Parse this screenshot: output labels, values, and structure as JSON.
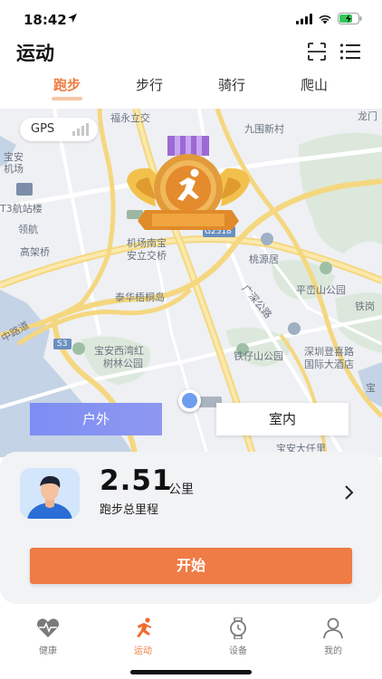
{
  "status_bar": {
    "time": "18:42"
  },
  "header": {
    "title": "运动",
    "icons": [
      "scan-icon",
      "menu-icon"
    ]
  },
  "tabs": [
    {
      "label": "跑步",
      "active": true
    },
    {
      "label": "步行",
      "active": false
    },
    {
      "label": "骑行",
      "active": false
    },
    {
      "label": "爬山",
      "active": false
    }
  ],
  "map": {
    "gps_label": "GPS",
    "labels": {
      "fuyongli": "福永立交",
      "jiuwei": "九围新村",
      "longhua": "龙门",
      "baoan_airport": "宝安",
      "jichang": "机场",
      "t3": "T3航站楼",
      "jichangnanbao": "机场南宝",
      "anlijiaoqiao": "安立交桥",
      "g2518": "G2518",
      "taoyuanju": "桃源居",
      "pingluanshan": "平峦山公园",
      "taihua": "泰华梧桐岛",
      "tiegang": "铁岗",
      "guangshen": "广深公路",
      "s3": "S3",
      "baoanxiwan": "宝安西湾红",
      "shulin": "树林公园",
      "tieziyshan": "铁仔山公园",
      "shenzhendengxi": "深圳登喜路",
      "guojidajiudian": "国际大酒店",
      "zhongjiedao": "中路道",
      "lingfeng": "领航",
      "gaojia": "高架桥",
      "baoandaqian": "宝安大仟里",
      "baolabel": "宝"
    },
    "mode_outdoor": "户外",
    "mode_indoor": "室内"
  },
  "summary": {
    "distance_value": "2.51",
    "distance_unit": "公里",
    "distance_label": "跑步总里程",
    "start_label": "开始"
  },
  "bottom_nav": [
    {
      "label": "健康",
      "icon": "heart-pulse-icon",
      "active": false
    },
    {
      "label": "运动",
      "icon": "runner-icon",
      "active": true
    },
    {
      "label": "设备",
      "icon": "watch-icon",
      "active": false
    },
    {
      "label": "我的",
      "icon": "user-icon",
      "active": false
    }
  ],
  "colors": {
    "accent": "#ef7b3f",
    "outdoor_button": "#8090f3",
    "start_button": "#ef7b45",
    "card_bg": "#f2f3f5"
  }
}
